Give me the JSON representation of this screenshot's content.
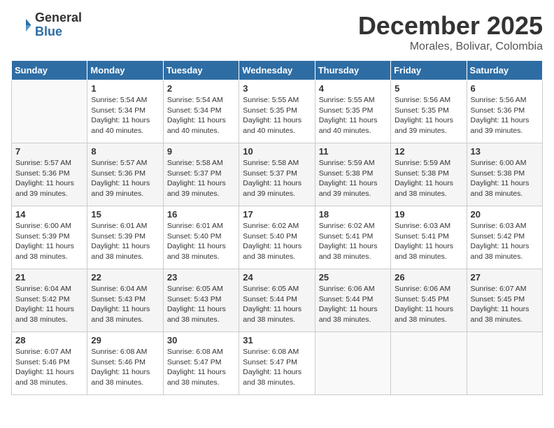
{
  "header": {
    "logo_general": "General",
    "logo_blue": "Blue",
    "month_title": "December 2025",
    "location": "Morales, Bolivar, Colombia"
  },
  "weekdays": [
    "Sunday",
    "Monday",
    "Tuesday",
    "Wednesday",
    "Thursday",
    "Friday",
    "Saturday"
  ],
  "weeks": [
    [
      {
        "day": "",
        "info": ""
      },
      {
        "day": "1",
        "info": "Sunrise: 5:54 AM\nSunset: 5:34 PM\nDaylight: 11 hours\nand 40 minutes."
      },
      {
        "day": "2",
        "info": "Sunrise: 5:54 AM\nSunset: 5:34 PM\nDaylight: 11 hours\nand 40 minutes."
      },
      {
        "day": "3",
        "info": "Sunrise: 5:55 AM\nSunset: 5:35 PM\nDaylight: 11 hours\nand 40 minutes."
      },
      {
        "day": "4",
        "info": "Sunrise: 5:55 AM\nSunset: 5:35 PM\nDaylight: 11 hours\nand 40 minutes."
      },
      {
        "day": "5",
        "info": "Sunrise: 5:56 AM\nSunset: 5:35 PM\nDaylight: 11 hours\nand 39 minutes."
      },
      {
        "day": "6",
        "info": "Sunrise: 5:56 AM\nSunset: 5:36 PM\nDaylight: 11 hours\nand 39 minutes."
      }
    ],
    [
      {
        "day": "7",
        "info": "Sunrise: 5:57 AM\nSunset: 5:36 PM\nDaylight: 11 hours\nand 39 minutes."
      },
      {
        "day": "8",
        "info": "Sunrise: 5:57 AM\nSunset: 5:36 PM\nDaylight: 11 hours\nand 39 minutes."
      },
      {
        "day": "9",
        "info": "Sunrise: 5:58 AM\nSunset: 5:37 PM\nDaylight: 11 hours\nand 39 minutes."
      },
      {
        "day": "10",
        "info": "Sunrise: 5:58 AM\nSunset: 5:37 PM\nDaylight: 11 hours\nand 39 minutes."
      },
      {
        "day": "11",
        "info": "Sunrise: 5:59 AM\nSunset: 5:38 PM\nDaylight: 11 hours\nand 39 minutes."
      },
      {
        "day": "12",
        "info": "Sunrise: 5:59 AM\nSunset: 5:38 PM\nDaylight: 11 hours\nand 38 minutes."
      },
      {
        "day": "13",
        "info": "Sunrise: 6:00 AM\nSunset: 5:38 PM\nDaylight: 11 hours\nand 38 minutes."
      }
    ],
    [
      {
        "day": "14",
        "info": "Sunrise: 6:00 AM\nSunset: 5:39 PM\nDaylight: 11 hours\nand 38 minutes."
      },
      {
        "day": "15",
        "info": "Sunrise: 6:01 AM\nSunset: 5:39 PM\nDaylight: 11 hours\nand 38 minutes."
      },
      {
        "day": "16",
        "info": "Sunrise: 6:01 AM\nSunset: 5:40 PM\nDaylight: 11 hours\nand 38 minutes."
      },
      {
        "day": "17",
        "info": "Sunrise: 6:02 AM\nSunset: 5:40 PM\nDaylight: 11 hours\nand 38 minutes."
      },
      {
        "day": "18",
        "info": "Sunrise: 6:02 AM\nSunset: 5:41 PM\nDaylight: 11 hours\nand 38 minutes."
      },
      {
        "day": "19",
        "info": "Sunrise: 6:03 AM\nSunset: 5:41 PM\nDaylight: 11 hours\nand 38 minutes."
      },
      {
        "day": "20",
        "info": "Sunrise: 6:03 AM\nSunset: 5:42 PM\nDaylight: 11 hours\nand 38 minutes."
      }
    ],
    [
      {
        "day": "21",
        "info": "Sunrise: 6:04 AM\nSunset: 5:42 PM\nDaylight: 11 hours\nand 38 minutes."
      },
      {
        "day": "22",
        "info": "Sunrise: 6:04 AM\nSunset: 5:43 PM\nDaylight: 11 hours\nand 38 minutes."
      },
      {
        "day": "23",
        "info": "Sunrise: 6:05 AM\nSunset: 5:43 PM\nDaylight: 11 hours\nand 38 minutes."
      },
      {
        "day": "24",
        "info": "Sunrise: 6:05 AM\nSunset: 5:44 PM\nDaylight: 11 hours\nand 38 minutes."
      },
      {
        "day": "25",
        "info": "Sunrise: 6:06 AM\nSunset: 5:44 PM\nDaylight: 11 hours\nand 38 minutes."
      },
      {
        "day": "26",
        "info": "Sunrise: 6:06 AM\nSunset: 5:45 PM\nDaylight: 11 hours\nand 38 minutes."
      },
      {
        "day": "27",
        "info": "Sunrise: 6:07 AM\nSunset: 5:45 PM\nDaylight: 11 hours\nand 38 minutes."
      }
    ],
    [
      {
        "day": "28",
        "info": "Sunrise: 6:07 AM\nSunset: 5:46 PM\nDaylight: 11 hours\nand 38 minutes."
      },
      {
        "day": "29",
        "info": "Sunrise: 6:08 AM\nSunset: 5:46 PM\nDaylight: 11 hours\nand 38 minutes."
      },
      {
        "day": "30",
        "info": "Sunrise: 6:08 AM\nSunset: 5:47 PM\nDaylight: 11 hours\nand 38 minutes."
      },
      {
        "day": "31",
        "info": "Sunrise: 6:08 AM\nSunset: 5:47 PM\nDaylight: 11 hours\nand 38 minutes."
      },
      {
        "day": "",
        "info": ""
      },
      {
        "day": "",
        "info": ""
      },
      {
        "day": "",
        "info": ""
      }
    ]
  ]
}
